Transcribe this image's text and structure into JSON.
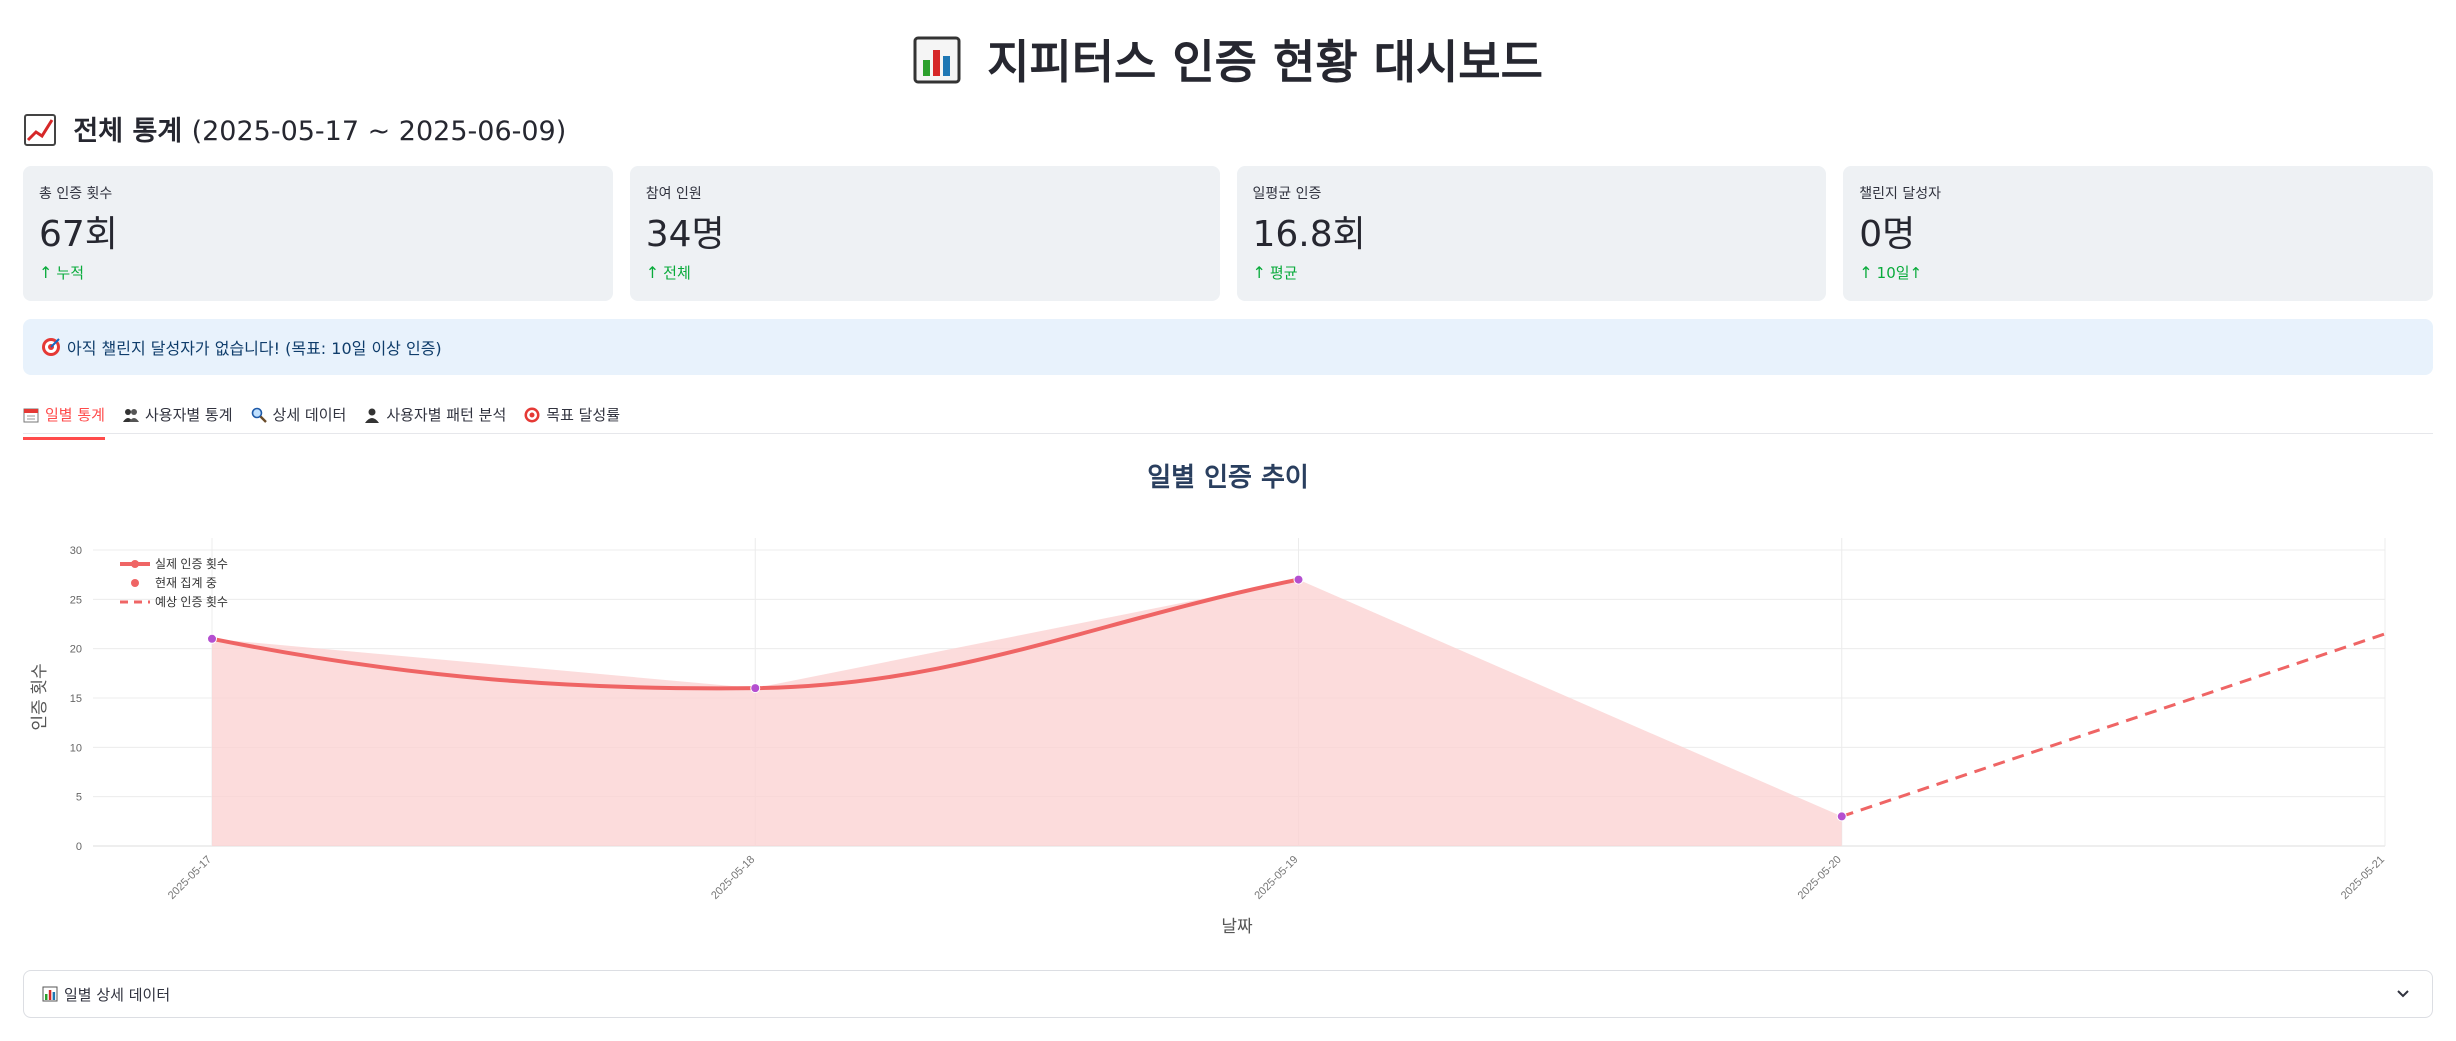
{
  "header": {
    "title": "지피터스 인증 현황 대시보드",
    "icon": "bar-chart-icon"
  },
  "overview": {
    "title": "전체 통계",
    "range": "(2025-05-17 ~ 2025-06-09)",
    "icon": "trending-up-icon"
  },
  "metrics": [
    {
      "label": "총 인증 횟수",
      "value": "67회",
      "delta": "누적"
    },
    {
      "label": "참여 인원",
      "value": "34명",
      "delta": "전체"
    },
    {
      "label": "일평균 인증",
      "value": "16.8회",
      "delta": "평균"
    },
    {
      "label": "챌린지 달성자",
      "value": "0명",
      "delta": "10일↑"
    }
  ],
  "info": {
    "text": "아직 챌린지 달성자가 없습니다! (목표: 10일 이상 인증)",
    "icon": "target-icon"
  },
  "tabs": [
    {
      "label": "일별 통계",
      "icon": "calendar-icon",
      "active": true
    },
    {
      "label": "사용자별 통계",
      "icon": "users-icon",
      "active": false
    },
    {
      "label": "상세 데이터",
      "icon": "magnifier-icon",
      "active": false
    },
    {
      "label": "사용자별 패턴 분석",
      "icon": "user-icon",
      "active": false
    },
    {
      "label": "목표 달성률",
      "icon": "target-icon",
      "active": false
    }
  ],
  "chart_data": {
    "type": "line",
    "title": "일별 인증 추이",
    "xlabel": "날짜",
    "ylabel": "인증 횟수",
    "ylim": [
      0,
      30
    ],
    "yticks": [
      0,
      5,
      10,
      15,
      20,
      25,
      30
    ],
    "categories": [
      "2025-05-17",
      "2025-05-18",
      "2025-05-19",
      "2025-05-20",
      "2025-05-21"
    ],
    "series": [
      {
        "name": "실제 인증 횟수",
        "x": [
          "2025-05-17",
          "2025-05-18",
          "2025-05-19",
          "2025-05-20"
        ],
        "values": [
          21,
          16,
          27,
          3
        ],
        "style": "solid",
        "color": "#ef6565"
      },
      {
        "name": "현재 집계 중",
        "x": [
          "2025-05-20"
        ],
        "values": [
          3
        ],
        "style": "marker",
        "color": "#ef6565"
      },
      {
        "name": "예상 인증 횟수",
        "x": [
          "2025-05-20",
          "2025-05-21"
        ],
        "values": [
          3,
          21.5
        ],
        "style": "dashed",
        "color": "#ef6565"
      }
    ],
    "fill_color": "#fbd3d3",
    "marker_color": "#b44fd0",
    "grid": true,
    "legend_position": "top-left"
  },
  "expander": {
    "label": "일별 상세 데이터",
    "icon": "bar-chart-icon"
  }
}
